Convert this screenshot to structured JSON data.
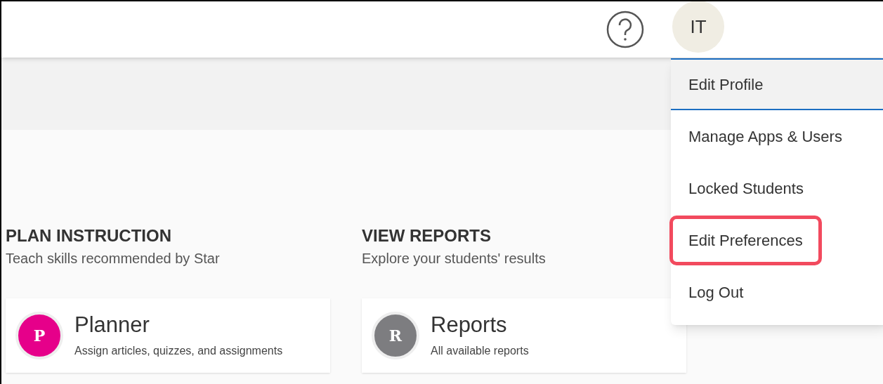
{
  "top_bar": {
    "avatar": {
      "initials": "IT"
    }
  },
  "user_menu": {
    "items": [
      {
        "label": "Edit Profile",
        "selected": true,
        "highlighted": false
      },
      {
        "label": "Manage Apps & Users",
        "selected": false,
        "highlighted": false
      },
      {
        "label": "Locked Students",
        "selected": false,
        "highlighted": false
      },
      {
        "label": "Edit Preferences",
        "selected": false,
        "highlighted": true
      },
      {
        "label": "Log Out",
        "selected": false,
        "highlighted": false
      }
    ]
  },
  "sections": [
    {
      "heading": "PLAN INSTRUCTION",
      "subtitle": "Teach skills recommended by Star",
      "card": {
        "letter": "P",
        "title": "Planner",
        "description": "Assign articles, quizzes, and assignments",
        "color": "#e6008a"
      }
    },
    {
      "heading": "VIEW REPORTS",
      "subtitle": "Explore your students' results",
      "card": {
        "letter": "R",
        "title": "Reports",
        "description": "All available reports",
        "color": "#7d7d80"
      }
    }
  ]
}
